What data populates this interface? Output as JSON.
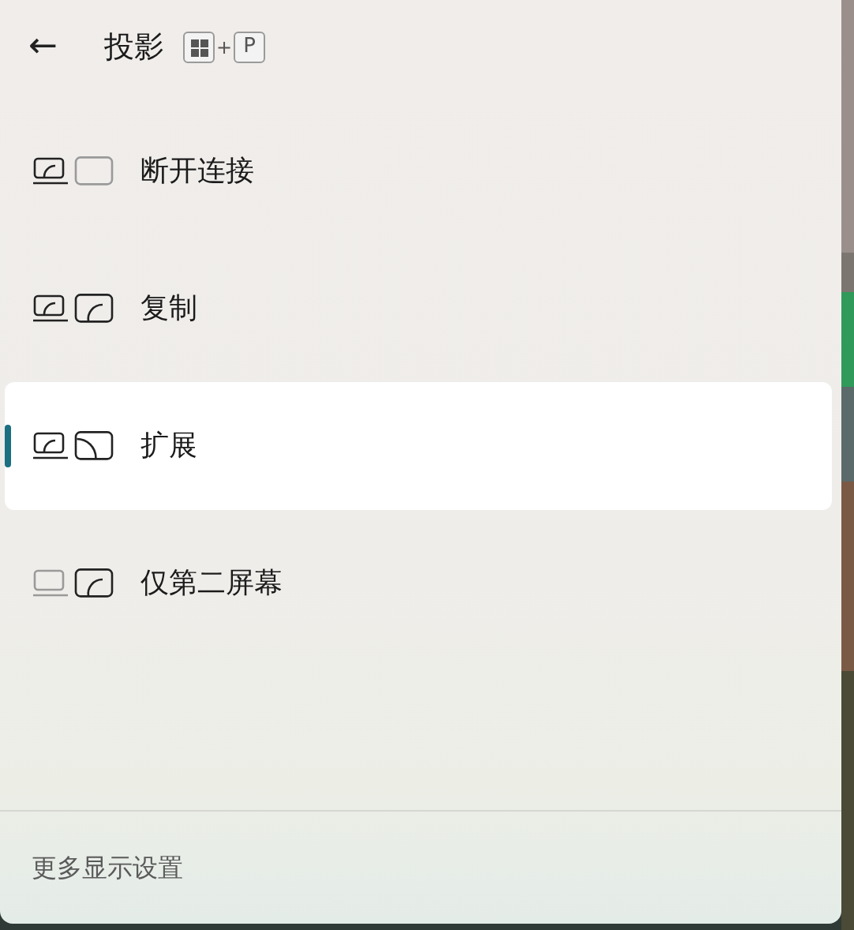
{
  "header": {
    "back": "←",
    "title": "投影",
    "shortcut": {
      "plus": "+",
      "key": "P"
    }
  },
  "modes": [
    {
      "kind": "pc-only",
      "label": "断开连接",
      "selected": false
    },
    {
      "kind": "duplicate",
      "label": "复制",
      "selected": false
    },
    {
      "kind": "extend",
      "label": "扩展",
      "selected": true
    },
    {
      "kind": "second-only",
      "label": "仅第二屏幕",
      "selected": false
    }
  ],
  "footer": {
    "link": "更多显示设置"
  }
}
